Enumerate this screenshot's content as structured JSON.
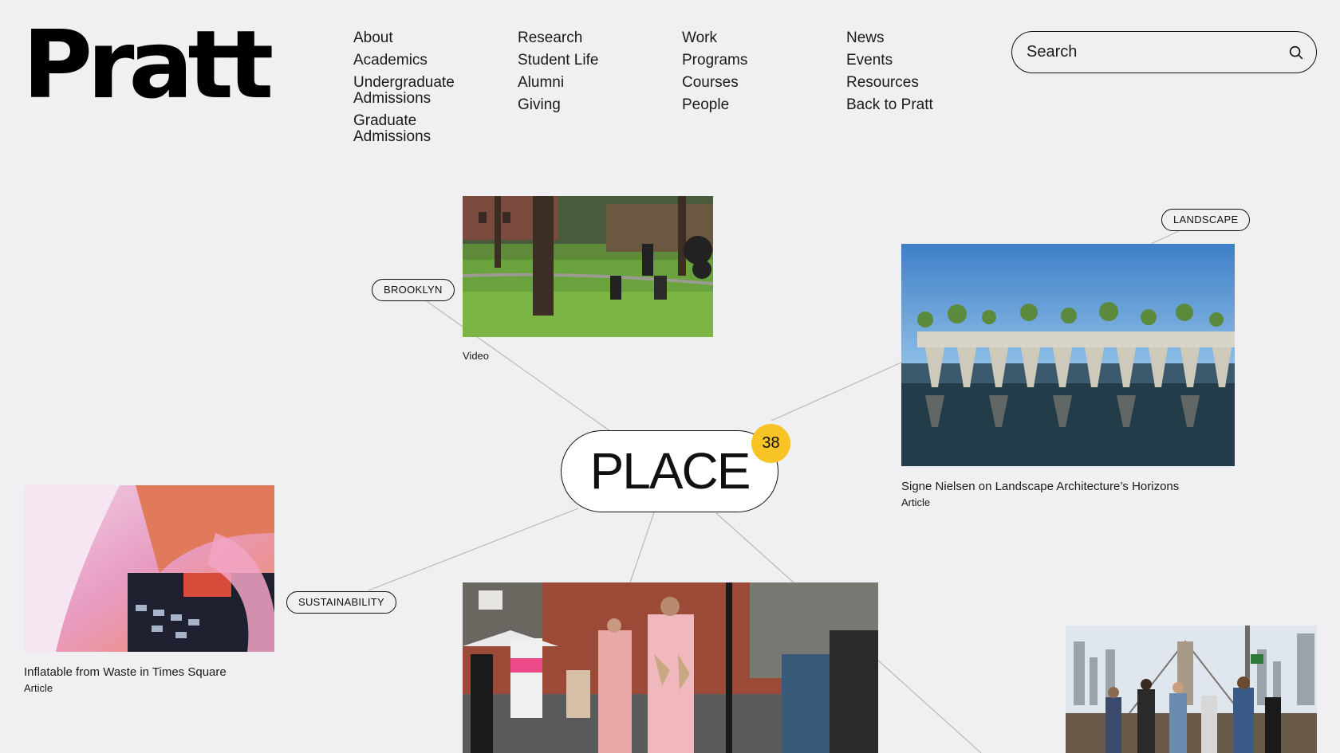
{
  "logo": "Pratt",
  "nav": {
    "col1": [
      "About",
      "Academics",
      "Undergraduate Admissions",
      "Graduate Admissions"
    ],
    "col2": [
      "Research",
      "Student Life",
      "Alumni",
      "Giving"
    ],
    "col3": [
      "Work",
      "Programs",
      "Courses",
      "People"
    ],
    "col4": [
      "News",
      "Events",
      "Resources",
      "Back to Pratt"
    ]
  },
  "search": {
    "placeholder": "Search",
    "icon": "search-icon"
  },
  "hub": {
    "label": "PLACE",
    "count": "38",
    "badge_color": "#f7c325"
  },
  "tags": {
    "brooklyn": "BROOKLYN",
    "landscape": "LANDSCAPE",
    "sustainability": "SUSTAINABILITY"
  },
  "cards": {
    "park": {
      "kind": "Video"
    },
    "landscape": {
      "title": "Signe Nielsen on Landscape Architecture’s Horizons",
      "kind": "Article"
    },
    "inflatable": {
      "title": "Inflatable from Waste in Times Square",
      "kind": "Article"
    },
    "runway": {},
    "bridge": {}
  }
}
